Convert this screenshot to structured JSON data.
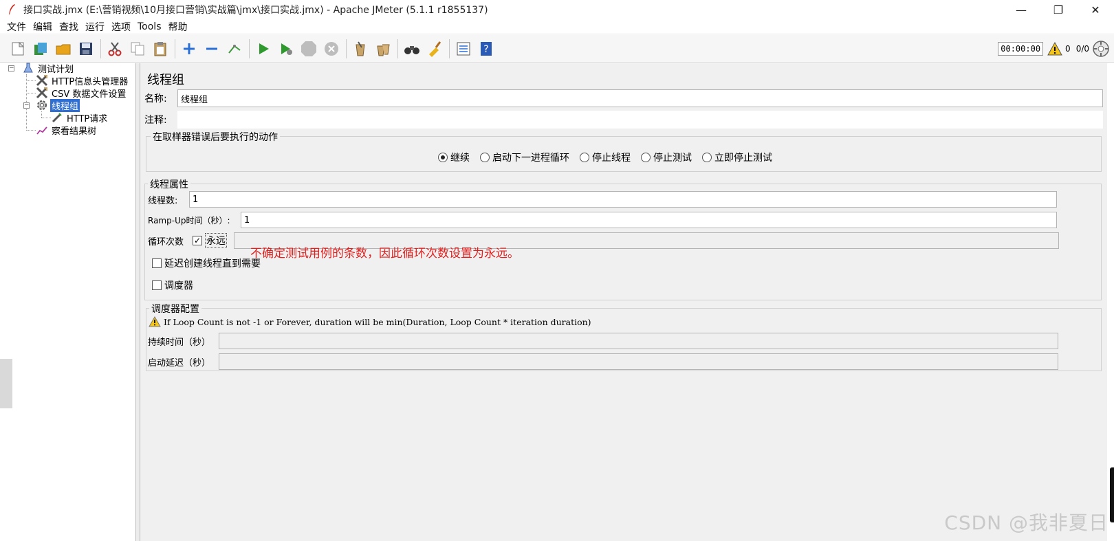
{
  "window": {
    "title": "接口实战.jmx (E:\\营销视频\\10月接口营销\\实战篇\\jmx\\接口实战.jmx) - Apache JMeter (5.1.1 r1855137)",
    "minimize": "—",
    "maximize": "❐",
    "close": "✕"
  },
  "menu": [
    "文件",
    "编辑",
    "查找",
    "运行",
    "选项",
    "Tools",
    "帮助"
  ],
  "toolbar": {
    "timer": "00:00:00",
    "warning_count": "0",
    "thread_ratio": "0/0"
  },
  "tree": {
    "root": "测试计划",
    "header_manager": "HTTP信息头管理器",
    "csv_config": "CSV 数据文件设置",
    "thread_group": "线程组",
    "http_request": "HTTP请求",
    "result_tree": "察看结果树"
  },
  "panel": {
    "title": "线程组",
    "name_label": "名称:",
    "name_value": "线程组",
    "comment_label": "注释:",
    "comment_value": "",
    "error_action": {
      "title": "在取样器错误后要执行的动作",
      "options": [
        "继续",
        "启动下一进程循环",
        "停止线程",
        "停止测试",
        "立即停止测试"
      ],
      "selected": "继续"
    },
    "thread_props": {
      "title": "线程属性",
      "threads_label": "线程数:",
      "threads_value": "1",
      "rampup_label": "Ramp-Up时间（秒）:",
      "rampup_value": "1",
      "loop_label": "循环次数",
      "forever_label": "永远",
      "forever_checked": true,
      "delay_label": "延迟创建线程直到需要",
      "scheduler_label": "调度器"
    },
    "annotation": "不确定测试用例的条数，因此循环次数设置为永远。",
    "scheduler_config": {
      "title": "调度器配置",
      "warning": "If Loop Count is not -1 or Forever, duration will be min(Duration, Loop Count * iteration duration)",
      "duration_label": "持续时间（秒）",
      "startup_delay_label": "启动延迟（秒）"
    }
  },
  "watermark": "CSDN @我非夏日"
}
